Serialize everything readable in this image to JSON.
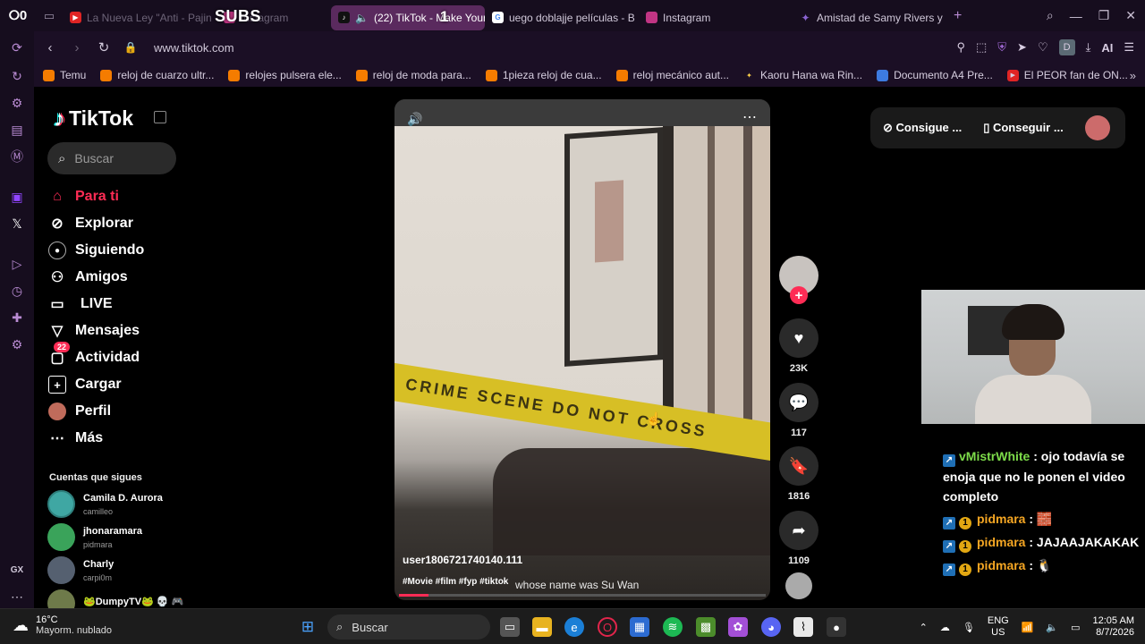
{
  "browser": {
    "workspace_count": "0",
    "tabs": [
      {
        "title": "La Nueva Ley \"Anti - Pajin",
        "fav_color": "#e02424"
      },
      {
        "title": "Instagram",
        "fav_color": "#c13584"
      },
      {
        "title": "(22) TikTok - Make Your",
        "fav_color": "#111111",
        "active": true
      },
      {
        "title": "uego doblajje películas - B",
        "fav_color": "#4285f4"
      },
      {
        "title": "Instagram",
        "fav_color": "#c13584"
      },
      {
        "title": "Amistad de Samy Rivers y",
        "fav_color": "#8a63d2"
      }
    ],
    "overlay_subs": "SUBS",
    "overlay_number": "1",
    "url": "www.tiktok.com",
    "profile_letter": "D",
    "ai_label": "AI",
    "bookmarks": [
      "Temu",
      "reloj de cuarzo ultr...",
      "relojes pulsera ele...",
      "reloj de moda para...",
      "1pieza reloj de cua...",
      "reloj mecánico aut...",
      "Kaoru Hana wa Rin...",
      "Documento A4 Pre...",
      "El PEOR fan de ON..."
    ],
    "sidebar_label": "GX"
  },
  "tiktok": {
    "logo": "TikTok",
    "search_placeholder": "Buscar",
    "nav": [
      {
        "label": "Para ti",
        "icon": "home-icon"
      },
      {
        "label": "Explorar",
        "icon": "compass-icon"
      },
      {
        "label": "Siguiendo",
        "icon": "following-icon"
      },
      {
        "label": "Amigos",
        "icon": "friends-icon"
      },
      {
        "label": "LIVE",
        "icon": "live-icon"
      },
      {
        "label": "Mensajes",
        "icon": "messages-icon"
      },
      {
        "label": "Actividad",
        "icon": "activity-icon",
        "badge": "22"
      },
      {
        "label": "Cargar",
        "icon": "upload-icon"
      },
      {
        "label": "Perfil",
        "icon": "profile-icon"
      },
      {
        "label": "Más",
        "icon": "more-icon"
      }
    ],
    "following_heading": "Cuentas que sigues",
    "following": [
      {
        "name": "Camila D. Aurora",
        "handle": "camilleo"
      },
      {
        "name": "jhonaramara",
        "handle": "pidmara"
      },
      {
        "name": "Charly",
        "handle": "carpi0m"
      },
      {
        "name": "🐸DumpyTV🐸 💀 🎮",
        "handle": ""
      }
    ],
    "video": {
      "username": "user1806721740140.111",
      "tags": "#Movie #film #fyp #tiktok",
      "caption": "whose name was Su Wan",
      "tape_text": "CRIME SCENE DO NOT CROSS",
      "progress": 0.08
    },
    "actions": {
      "likes": "23K",
      "comments": "117",
      "saves": "1816",
      "shares": "1109"
    },
    "get_app": [
      "Consigue ...",
      "Conseguir ..."
    ]
  },
  "stream": {
    "chat": [
      {
        "user": "vMistrWhite",
        "text": "ojo todavía se enoja que no le ponen el video completo",
        "color": "#7ddc4a"
      },
      {
        "user": "pidmara",
        "text": "🧱",
        "color": "#f5a623"
      },
      {
        "user": "pidmara",
        "text": "JAJAAJAKAKAK",
        "color": "#f5a623"
      },
      {
        "user": "pidmara",
        "text": "🐧",
        "color": "#f5a623"
      }
    ]
  },
  "taskbar": {
    "temp": "16°C",
    "weather": "Mayorm. nublado",
    "search": "Buscar",
    "lang1": "ENG",
    "lang2": "US",
    "time": "12:05 AM",
    "date": "8/7/2026"
  }
}
